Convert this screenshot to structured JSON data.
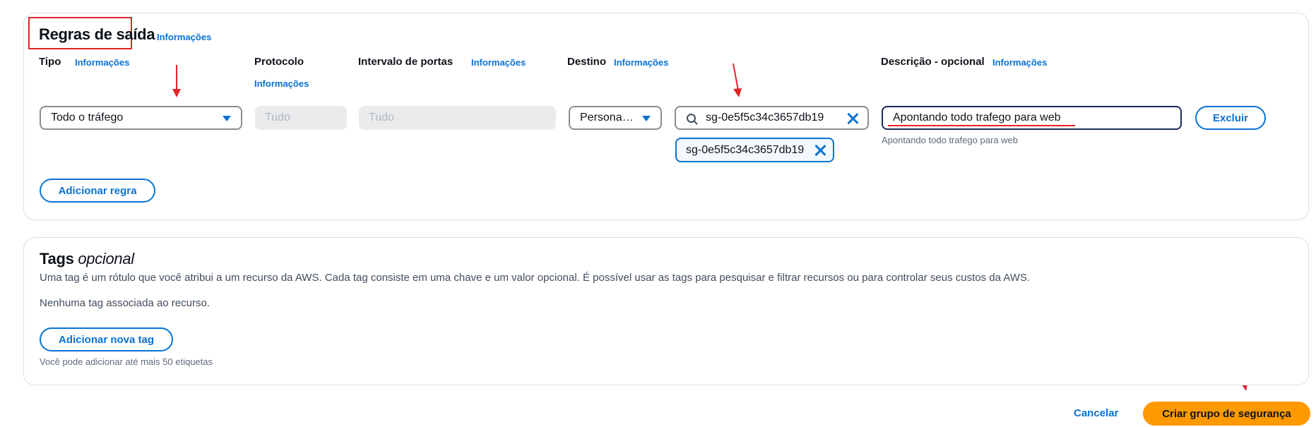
{
  "outbound": {
    "title": "Regras de saída",
    "info_link": "Informações",
    "labels": {
      "type": "Tipo",
      "protocol": "Protocolo",
      "port_range": "Intervalo de portas",
      "destination": "Destino",
      "description": "Descrição - opcional"
    },
    "info": "Informações",
    "rule": {
      "type_value": "Todo o tráfego",
      "protocol_value": "Tudo",
      "port_value": "Tudo",
      "destination_value": "Persona…",
      "search_value": "sg-0e5f5c34c3657db19",
      "token_value": "sg-0e5f5c34c3657db19",
      "description_value": "Apontando todo trafego para web",
      "description_hint": "Apontando todo trafego para web",
      "delete_label": "Excluir"
    },
    "add_rule_label": "Adicionar regra"
  },
  "tags": {
    "title_main": "Tags",
    "title_optional": "opcional",
    "description": "Uma tag é um rótulo que você atribui a um recurso da AWS. Cada tag consiste em uma chave e um valor opcional. É possível usar as tags para pesquisar e filtrar recursos ou para controlar seus custos da AWS.",
    "empty_text": "Nenhuma tag associada ao recurso.",
    "add_tag_label": "Adicionar nova tag",
    "limit_text": "Você pode adicionar até mais 50 etiquetas"
  },
  "footer": {
    "cancel_label": "Cancelar",
    "create_label": "Criar grupo de segurança"
  },
  "colors": {
    "accent": "#0972d3",
    "primary_button": "#ff9900",
    "annotation": "#e0242b"
  },
  "icons": [
    "chevron-down-icon",
    "search-icon",
    "close-icon"
  ]
}
